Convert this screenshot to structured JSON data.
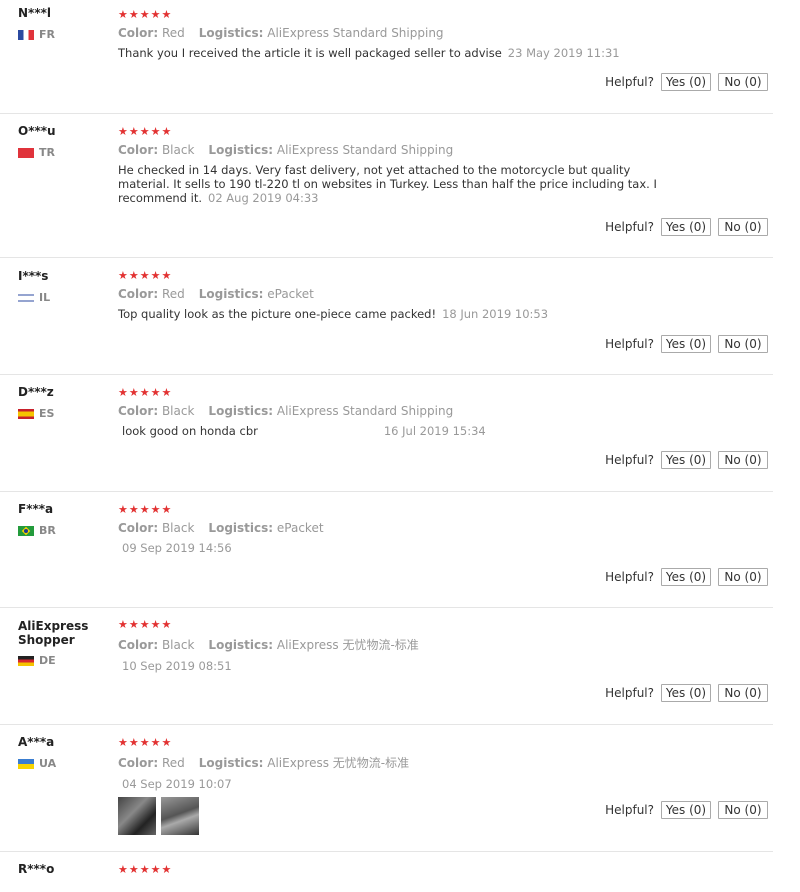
{
  "labels": {
    "color": "Color:",
    "logistics": "Logistics:",
    "helpful": "Helpful?",
    "yes": "Yes (0)",
    "no": "No (0)"
  },
  "stars": "★★★★★",
  "reviews": [
    {
      "user": "N***l",
      "country": "FR",
      "color": "Red",
      "logistics": "AliExpress Standard Shipping",
      "text": "Thank you I received the article it is well packaged seller to advise",
      "date": "23 May 2019 11:31"
    },
    {
      "user": "O***u",
      "country": "TR",
      "color": "Black",
      "logistics": "AliExpress Standard Shipping",
      "text": "He checked in 14 days. Very fast delivery, not yet attached to the motorcycle but quality material. It sells to 190 tl-220 tl on websites in Turkey. Less than half the price including tax. I recommend it.",
      "date": "02 Aug 2019 04:33"
    },
    {
      "user": "I***s",
      "country": "IL",
      "color": "Red",
      "logistics": "ePacket",
      "text": "Top quality look as the picture one-piece came packed!",
      "date": "18 Jun 2019 10:53"
    },
    {
      "user": "D***z",
      "country": "ES",
      "color": "Black",
      "logistics": "AliExpress Standard Shipping",
      "text": "look good on honda cbr",
      "date": "16 Jul 2019 15:34"
    },
    {
      "user": "F***a",
      "country": "BR",
      "color": "Black",
      "logistics": "ePacket",
      "text": "",
      "date": "09 Sep 2019 14:56"
    },
    {
      "user": "AliExpress Shopper",
      "country": "DE",
      "color": "Black",
      "logistics": "AliExpress 无忧物流-标准",
      "text": "",
      "date": "10 Sep 2019 08:51"
    },
    {
      "user": "A***a",
      "country": "UA",
      "color": "Red",
      "logistics": "AliExpress 无忧物流-标准",
      "text": "",
      "date": "04 Sep 2019 10:07"
    },
    {
      "user": "R***o",
      "country": "",
      "color": "",
      "logistics": "",
      "text": "",
      "date": ""
    }
  ]
}
